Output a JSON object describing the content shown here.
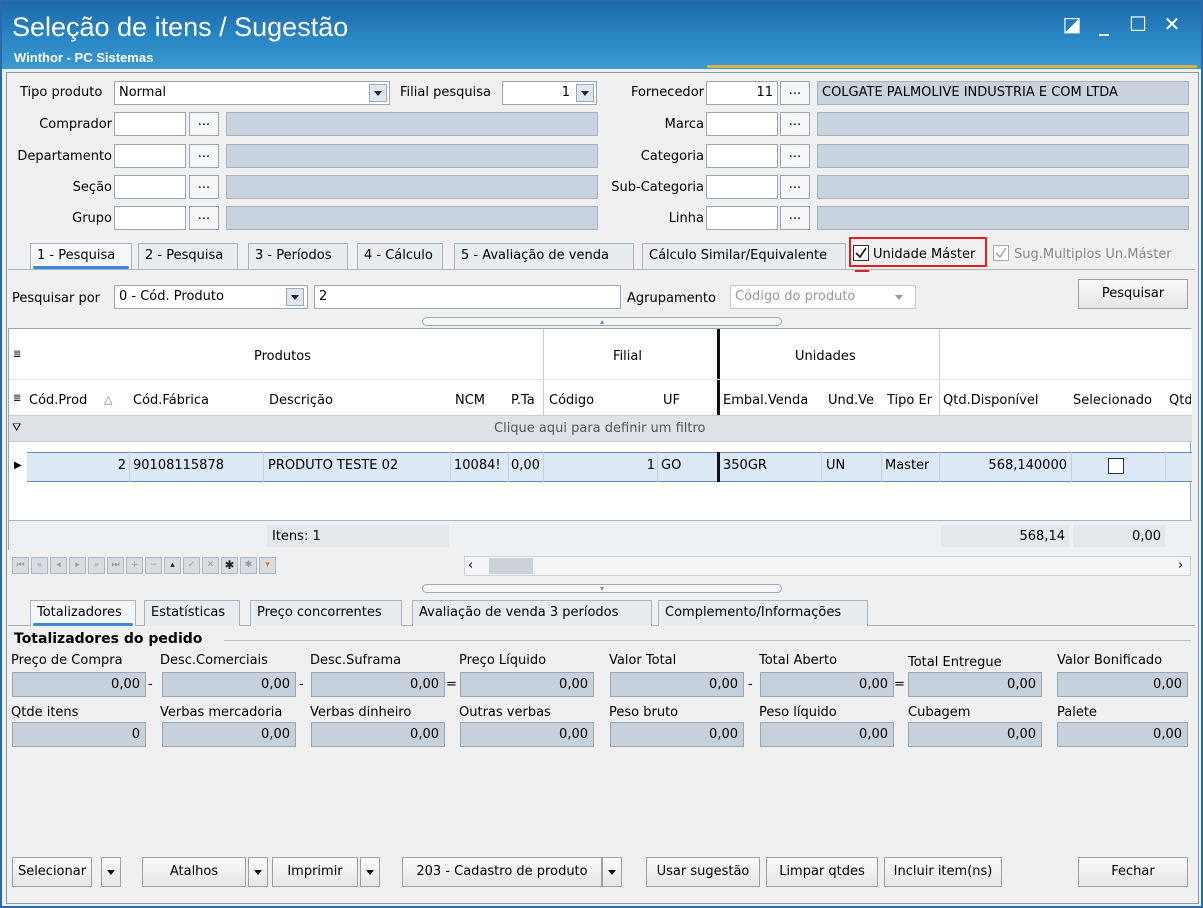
{
  "window": {
    "title": "Seleção de itens / Sugestão",
    "subtitle": "Winthor - PC Sistemas",
    "controls": [
      "◪",
      "_",
      "☐",
      "✕"
    ]
  },
  "filters": {
    "tipo_produto_label": "Tipo produto",
    "tipo_produto_value": "Normal",
    "filial_pesquisa_label": "Filial pesquisa",
    "filial_pesquisa_value": "1",
    "fornecedor_label": "Fornecedor",
    "fornecedor_code": "11",
    "fornecedor_name": "COLGATE PALMOLIVE INDUSTRIA  E COM LTDA",
    "comprador_label": "Comprador",
    "departamento_label": "Departamento",
    "secao_label": "Seção",
    "grupo_label": "Grupo",
    "marca_label": "Marca",
    "categoria_label": "Categoria",
    "subcategoria_label": "Sub-Categoria",
    "linha_label": "Linha",
    "dots": "..."
  },
  "tabs_top": [
    {
      "label": "1 - Pesquisa"
    },
    {
      "label": "2 - Pesquisa"
    },
    {
      "label": "3 - Períodos"
    },
    {
      "label": "4 - Cálculo"
    },
    {
      "label": "5 - Avaliação de venda"
    },
    {
      "label": "Cálculo Similar/Equivalente"
    }
  ],
  "options": {
    "unidade_master": "Unidade Máster",
    "sug_multiplos": "Sug.Multiplos Un.Máster"
  },
  "search": {
    "pesquisar_por_label": "Pesquisar por",
    "pesquisar_por_value": "0 - Cód. Produto",
    "query": "2",
    "agrupamento_label": "Agrupamento",
    "agrupamento_value": "Código do produto",
    "button": "Pesquisar"
  },
  "grid": {
    "bands": [
      "Produtos",
      "Filial",
      "Unidades"
    ],
    "columns": [
      "Cód.Prod",
      "Cód.Fábrica",
      "Descrição",
      "NCM",
      "P.Ta",
      "Código",
      "UF",
      "Embal.Venda",
      "Und.Ve",
      "Tipo Er",
      "Qtd.Disponível",
      "Selecionado",
      "Qtd"
    ],
    "filter_hint": "Clique aqui para definir um filtro",
    "rows": [
      {
        "cod_prod": "2",
        "cod_fabrica": "90108115878",
        "descricao": "PRODUTO TESTE 02",
        "ncm": "10084!",
        "pta": "0,00",
        "codigo": "1",
        "uf": "GO",
        "embal": "350GR",
        "und": "UN",
        "tipo": "Master",
        "qtd_disp": "568,140000",
        "selecionado": false
      }
    ],
    "footer": {
      "itens": "Itens: 1",
      "sum_disp": "568,14",
      "sum_sel": "0,00"
    },
    "nav_buttons": [
      "first",
      "prev-page",
      "prev",
      "next",
      "next-page",
      "last",
      "insert",
      "delete",
      "edit",
      "post",
      "cancel",
      "bookmark",
      "refresh",
      "filter"
    ]
  },
  "tabs_bottom": [
    {
      "label": "Totalizadores"
    },
    {
      "label": "Estatísticas"
    },
    {
      "label": "Preço concorrentes"
    },
    {
      "label": "Avaliação de venda 3 períodos"
    },
    {
      "label": "Complemento/Informações"
    }
  ],
  "totals": {
    "section_title": "Totalizadores do pedido",
    "row1": [
      {
        "label": "Preço de Compra",
        "value": "0,00",
        "op": "-"
      },
      {
        "label": "Desc.Comerciais",
        "value": "0,00",
        "op": "-"
      },
      {
        "label": "Desc.Suframa",
        "value": "0,00",
        "op": "="
      },
      {
        "label": "Preço Líquido",
        "value": "0,00",
        "op": ""
      },
      {
        "label": "Valor Total",
        "value": "0,00",
        "op": "-"
      },
      {
        "label": "Total Aberto",
        "value": "0,00",
        "op": "="
      },
      {
        "label": "Total Entregue",
        "value": "0,00",
        "op": ""
      },
      {
        "label": "Valor Bonificado",
        "value": "0,00",
        "op": ""
      }
    ],
    "row2": [
      {
        "label": "Qtde itens",
        "value": "0"
      },
      {
        "label": "Verbas mercadoria",
        "value": "0,00"
      },
      {
        "label": "Verbas dinheiro",
        "value": "0,00"
      },
      {
        "label": "Outras verbas",
        "value": "0,00"
      },
      {
        "label": "Peso bruto",
        "value": "0,00"
      },
      {
        "label": "Peso líquido",
        "value": "0,00"
      },
      {
        "label": "Cubagem",
        "value": "0,00"
      },
      {
        "label": "Palete",
        "value": "0,00"
      }
    ]
  },
  "bottom_buttons": {
    "selecionar": "Selecionar",
    "atalhos": "Atalhos",
    "imprimir": "Imprimir",
    "cadastro": "203 - Cadastro de produto",
    "usar_sugestao": "Usar sugestão",
    "limpar_qtdes": "Limpar qtdes",
    "incluir_itens": "Incluir item(ns)",
    "fechar": "Fechar"
  },
  "colors": {
    "title_bg": "#2a86c4",
    "highlight": "#e02020",
    "accent": "#3a8ad8"
  }
}
